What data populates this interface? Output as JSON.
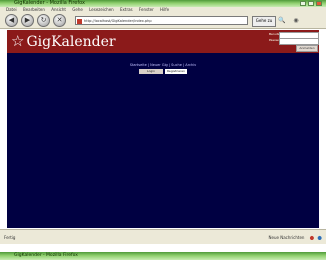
{
  "window": {
    "title": "GigKalender - Mozilla Firefox",
    "controls": [
      "_",
      "□",
      "×"
    ]
  },
  "menu": [
    "Datei",
    "Bearbeiten",
    "Ansicht",
    "Gehe",
    "Lesezeichen",
    "Extras",
    "Fenster",
    "Hilfe"
  ],
  "toolbar": {
    "url": "http://localhost/GigKalender/index.php",
    "go_label": "Gehe zu",
    "nav": [
      "◀",
      "▶",
      "↻",
      "✕"
    ]
  },
  "page": {
    "logo_text": "GigKalender",
    "login": {
      "user_label": "Benutzer",
      "pass_label": "Passwort",
      "submit_label": "Anmelden"
    },
    "center_links": "Startseite | Neuer Gig | Suche | Archiv",
    "center_buttons": [
      "Login",
      "Registrieren"
    ]
  },
  "status": {
    "left": "Fertig",
    "right": "Neue Nachrichten"
  },
  "taskbar2": {
    "title": "GigKalender - Mozilla Firefox"
  },
  "colors": {
    "header_red": "#8b1a1a",
    "page_navy": "#000042",
    "chrome": "#ece9d8"
  }
}
